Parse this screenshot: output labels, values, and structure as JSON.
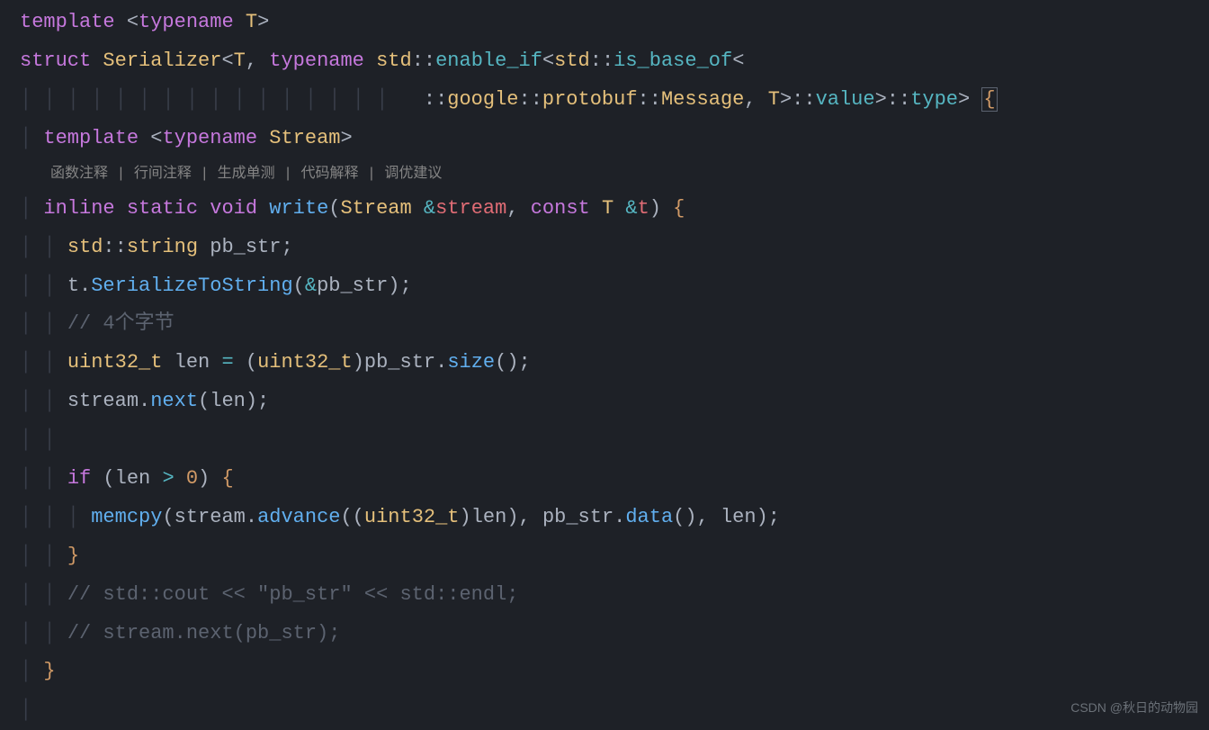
{
  "codelens": {
    "items": [
      "函数注释",
      "行间注释",
      "生成单测",
      "代码解释",
      "调优建议"
    ],
    "sep": " | "
  },
  "watermark": "CSDN @秋日的动物园",
  "tokens": {
    "template": "template",
    "typename": "typename",
    "T": "T",
    "struct": "struct",
    "Serializer": "Serializer",
    "std": "std",
    "enable_if": "enable_if",
    "is_base_of": "is_base_of",
    "google": "google",
    "protobuf": "protobuf",
    "Message": "Message",
    "value": "value",
    "type": "type",
    "Stream": "Stream",
    "inline": "inline",
    "static": "static",
    "void": "void",
    "write": "write",
    "stream": "stream",
    "const": "const",
    "t": "t",
    "string": "string",
    "pb_str": "pb_str",
    "SerializeToString": "SerializeToString",
    "comment4bytes": "// 4个字节",
    "uint32_t": "uint32_t",
    "len": "len",
    "size": "size",
    "next": "next",
    "if": "if",
    "zero": "0",
    "memcpy": "memcpy",
    "advance": "advance",
    "data": "data",
    "commentCout": "// std::cout << \"pb_str\" << std::endl;",
    "commentNext": "// stream.next(pb_str);"
  }
}
